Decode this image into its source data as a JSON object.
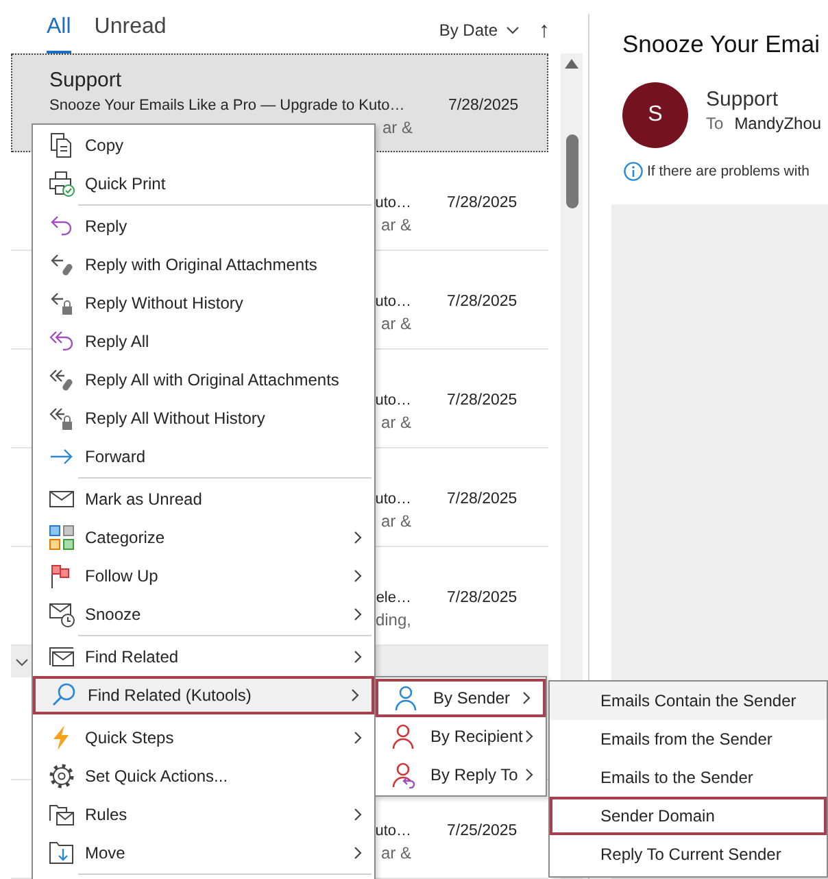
{
  "filter_tabs": [
    {
      "label": "All",
      "selected": true
    },
    {
      "label": "Unread",
      "selected": false
    }
  ],
  "sort": {
    "label": "By Date",
    "direction": "↑"
  },
  "messages": [
    {
      "kind": "message",
      "sender": "Support",
      "subject": "Snooze Your Emails Like a Pro — Upgrade to Kuto…",
      "preview": "ar &",
      "date": "7/28/2025",
      "selected": true
    },
    {
      "kind": "message",
      "subject": "uto…",
      "preview": "ar &",
      "date": "7/28/2025",
      "selected": false
    },
    {
      "kind": "message",
      "subject": "uto…",
      "preview": "ar &",
      "date": "7/28/2025",
      "selected": false
    },
    {
      "kind": "message",
      "subject": "uto…",
      "preview": "ar &",
      "date": "7/28/2025",
      "selected": false
    },
    {
      "kind": "message",
      "subject": "uto…",
      "preview": "ar &",
      "date": "7/28/2025",
      "selected": false
    },
    {
      "kind": "message",
      "subject": "ele…",
      "preview": "ding,",
      "date": "7/28/2025",
      "selected": false
    },
    {
      "kind": "group_header"
    },
    {
      "kind": "message",
      "subject": "uto…",
      "preview": "ar &",
      "date": "7/25/2025",
      "selected": false
    }
  ],
  "context_menu": {
    "items": [
      {
        "kind": "item",
        "label": "Copy",
        "submenu": false,
        "selected": false
      },
      {
        "kind": "item",
        "label": "Quick Print",
        "submenu": false,
        "selected": false
      },
      {
        "kind": "separator"
      },
      {
        "kind": "item",
        "label": "Reply",
        "submenu": false,
        "selected": false
      },
      {
        "kind": "item",
        "label": "Reply with Original Attachments",
        "submenu": false,
        "selected": false
      },
      {
        "kind": "item",
        "label": "Reply Without History",
        "submenu": false,
        "selected": false
      },
      {
        "kind": "item",
        "label": "Reply All",
        "submenu": false,
        "selected": false
      },
      {
        "kind": "item",
        "label": "Reply All with Original Attachments",
        "submenu": false,
        "selected": false
      },
      {
        "kind": "item",
        "label": "Reply All Without History",
        "submenu": false,
        "selected": false
      },
      {
        "kind": "item",
        "label": "Forward",
        "submenu": false,
        "selected": false
      },
      {
        "kind": "separator"
      },
      {
        "kind": "item",
        "label": "Mark as Unread",
        "submenu": false,
        "selected": false
      },
      {
        "kind": "item",
        "label": "Categorize",
        "submenu": true,
        "selected": false
      },
      {
        "kind": "item",
        "label": "Follow Up",
        "submenu": true,
        "selected": false
      },
      {
        "kind": "item",
        "label": "Snooze",
        "submenu": true,
        "selected": false
      },
      {
        "kind": "separator"
      },
      {
        "kind": "item",
        "label": "Find Related",
        "submenu": true,
        "selected": false
      },
      {
        "kind": "item",
        "label": "Find Related (Kutools)",
        "submenu": true,
        "selected": true
      },
      {
        "kind": "item",
        "label": "Quick Steps",
        "submenu": true,
        "selected": false
      },
      {
        "kind": "item",
        "label": "Set Quick Actions...",
        "submenu": false,
        "selected": false
      },
      {
        "kind": "item",
        "label": "Rules",
        "submenu": true,
        "selected": false
      },
      {
        "kind": "item",
        "label": "Move",
        "submenu": true,
        "selected": false
      },
      {
        "kind": "separator"
      }
    ]
  },
  "kutools_submenu": {
    "items": [
      {
        "label": "By Sender",
        "submenu": true,
        "selected": true
      },
      {
        "label": "By Recipient",
        "submenu": true,
        "selected": false
      },
      {
        "label": "By Reply To",
        "submenu": true,
        "selected": false
      }
    ]
  },
  "sender_submenu": {
    "items": [
      {
        "label": "Emails Contain the Sender",
        "hovered": true,
        "selected": false
      },
      {
        "label": "Emails from the Sender",
        "hovered": false,
        "selected": false
      },
      {
        "label": "Emails to the Sender",
        "hovered": false,
        "selected": false
      },
      {
        "label": "Sender Domain",
        "hovered": false,
        "selected": true
      },
      {
        "label": "Reply To Current Sender",
        "hovered": false,
        "selected": false
      }
    ]
  },
  "reading_pane": {
    "title": "Snooze Your Emai",
    "avatar_initial": "S",
    "sender": "Support",
    "to_label": "To",
    "recipient": "MandyZhou",
    "info_text": "If there are problems with"
  }
}
